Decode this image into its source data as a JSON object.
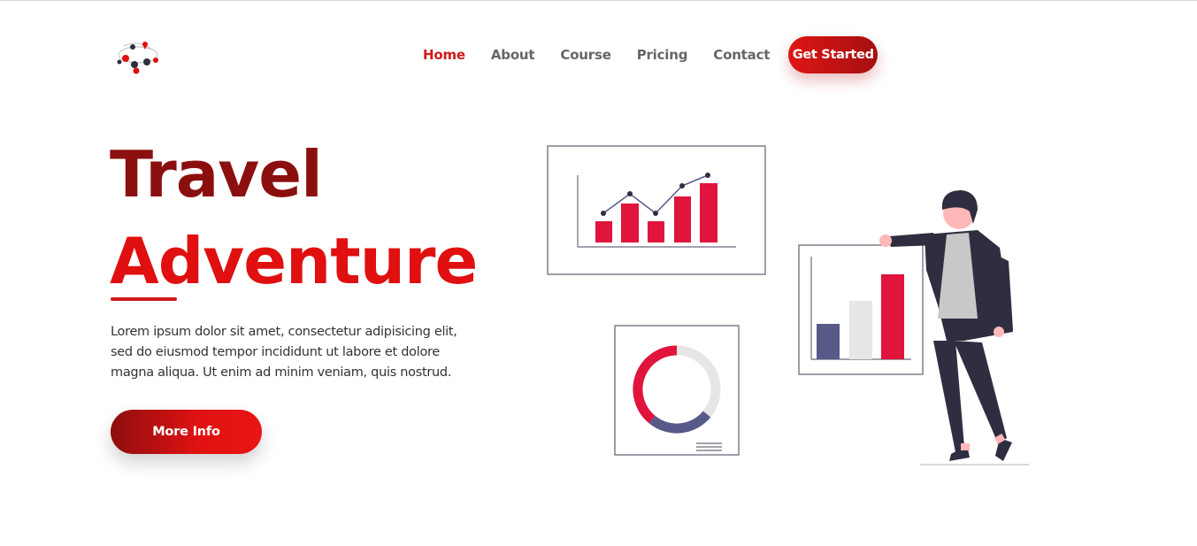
{
  "nav": {
    "items": [
      {
        "label": "Home",
        "active": true
      },
      {
        "label": "About",
        "active": false
      },
      {
        "label": "Course",
        "active": false
      },
      {
        "label": "Pricing",
        "active": false
      },
      {
        "label": "Contact",
        "active": false
      }
    ],
    "cta_label": "Get Started"
  },
  "hero": {
    "title_line1": "Travel",
    "title_line2": "Adventure",
    "description": "Lorem ipsum dolor sit amet, consectetur adipisicing elit, sed do eiusmod tempor incididunt ut labore et dolore magna aliqua. Ut enim ad minim veniam, quis nostrud.",
    "button_label": "More Info"
  },
  "colors": {
    "brand_red": "#e01010",
    "brand_dark_red": "#8c0f0f",
    "nav_text": "#666666",
    "illustration_red": "#e0143c",
    "illustration_navy": "#575a89",
    "illustration_dark": "#2f2e41"
  },
  "icons": {
    "logo": "travel-logo-icon"
  }
}
